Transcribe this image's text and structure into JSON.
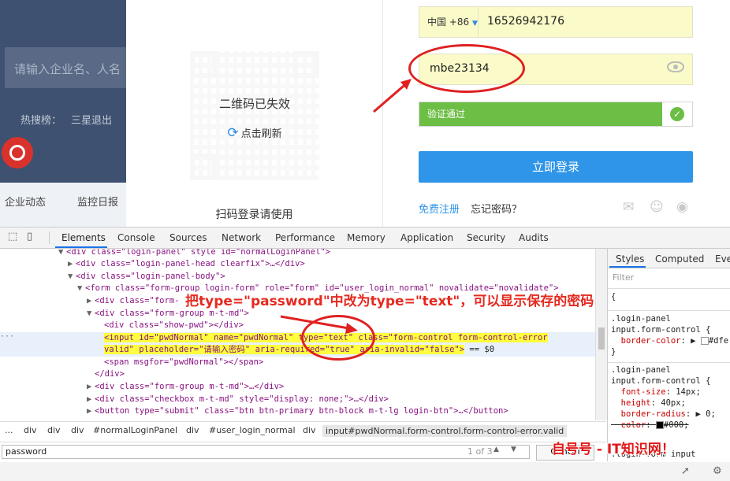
{
  "background_page": {
    "search_placeholder": "请输入企业名、人名",
    "hot_label": "热搜榜：",
    "hot_keyword": "三星退出",
    "nav_items": [
      "企业动态",
      "监控日报"
    ]
  },
  "qr_panel": {
    "expired_text": "二维码已失效",
    "refresh_text": "点击刷新",
    "caption": "扫码登录请使用"
  },
  "login_form": {
    "country_name": "中国",
    "country_code": "+86",
    "phone": "16526942176",
    "password": "mbe23134",
    "verify_text": "验证通过",
    "login_button": "立即登录",
    "register_link": "免费注册",
    "forgot_link": "忘记密码？"
  },
  "devtools": {
    "tabs": [
      "Elements",
      "Console",
      "Sources",
      "Network",
      "Performance",
      "Memory",
      "Application",
      "Security",
      "Audits"
    ],
    "active_tab": "Elements",
    "dom_lines": [
      "<div class=\"login-panel\" style id=\"normalLoginPanel\">",
      "<div class=\"login-panel-head clearfix\">…</div>",
      "<div class=\"login-panel-body\">",
      "<form class=\"form-group login-form\" role=\"form\" id=\"user_login_normal\" novalidate=\"novalidate\">",
      "<div class=\"form-",
      "<div class=\"form-group m-t-md\">",
      "<div class=\"show-pwd\"></div>",
      "<input id=\"pwdNormal\" name=\"pwdNormal\" type=\"text\" class=\"form-control form-control-error",
      "valid\" placeholder=\"请输入密码\" aria-required=\"true\" aria-invalid=\"false\">",
      "== $0",
      "<span msgfor=\"pwdNormal\"></span>",
      "</div>",
      "<div class=\"form-group m-t-md\">…</div>",
      "<div class=\"checkbox m-t-md\" style=\"display: none;\">…</div>",
      "<button type=\"submit\" class=\"btn btn-primary btn-block m-t-lg login-btn\">…</button>"
    ],
    "annotation": "把type=\"password\"中改为type=\"text\"，可以显示保存的密码",
    "breadcrumb": [
      "...",
      "div",
      "div",
      "div",
      "#normalLoginPanel",
      "div",
      "#user_login_normal",
      "div",
      "input#pwdNormal.form-control.form-control-error.valid"
    ],
    "search_value": "password",
    "search_count": "1 of 3",
    "cancel_label": "Cancel",
    "styles_tabs": [
      "Styles",
      "Computed",
      "Event"
    ],
    "filter_placeholder": "Filter",
    "style_rules": [
      {
        "selector1": ".login-panel",
        "selector2": "input.form-control {",
        "decls": [
          [
            "border-color",
            "#dfe"
          ]
        ],
        "close": "}"
      },
      {
        "selector1": ".login-panel",
        "selector2": "input.form-control {",
        "decls": [
          [
            "font-size",
            "14px;"
          ],
          [
            "height",
            "40px;"
          ],
          [
            "border-radius",
            "0;"
          ],
          [
            "color",
            "#000;"
          ]
        ],
        "close": ""
      }
    ],
    "next_rule_selector": ".login-form input"
  },
  "watermark": "自号号 - IT知识网！"
}
